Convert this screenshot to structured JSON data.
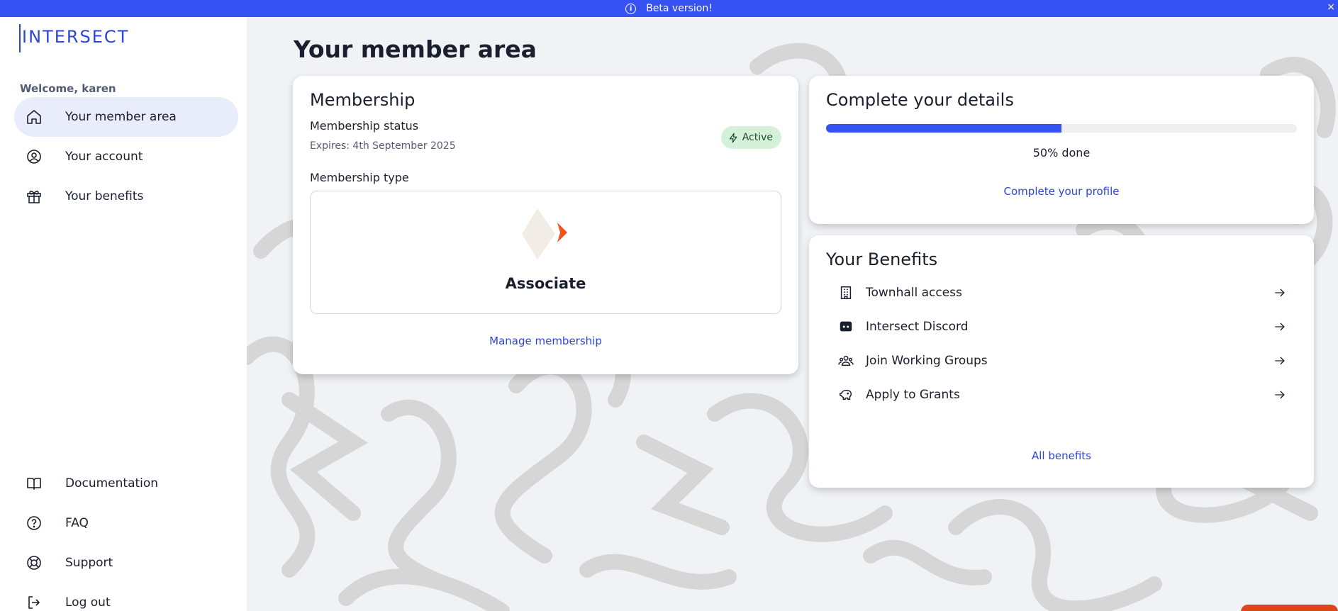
{
  "banner": {
    "text": "Beta version!",
    "close": "×"
  },
  "logo": {
    "text": "INTERSECT"
  },
  "welcome": "Welcome, karen",
  "nav": {
    "primary": [
      {
        "label": "Your member area",
        "icon": "home-icon",
        "active": true
      },
      {
        "label": "Your account",
        "icon": "user-circle-icon",
        "active": false
      },
      {
        "label": "Your benefits",
        "icon": "gift-icon",
        "active": false
      }
    ],
    "secondary": [
      {
        "label": "Documentation",
        "icon": "book-icon"
      },
      {
        "label": "FAQ",
        "icon": "help-circle-icon"
      },
      {
        "label": "Support",
        "icon": "lifebuoy-icon"
      },
      {
        "label": "Log out",
        "icon": "logout-icon"
      }
    ]
  },
  "page_title": "Your member area",
  "membership": {
    "title": "Membership",
    "status_label": "Membership status",
    "expires": "Expires: 4th September 2025",
    "badge": "Active",
    "type_label": "Membership type",
    "type_name": "Associate",
    "manage_link": "Manage membership"
  },
  "details": {
    "title": "Complete your details",
    "progress_percent": 50,
    "progress_text": "50% done",
    "link": "Complete your profile"
  },
  "benefits": {
    "title": "Your Benefits",
    "items": [
      {
        "label": "Townhall access",
        "icon": "building-icon"
      },
      {
        "label": "Intersect Discord",
        "icon": "discord-icon"
      },
      {
        "label": "Join Working Groups",
        "icon": "users-icon"
      },
      {
        "label": "Apply to Grants",
        "icon": "piggy-bank-icon"
      }
    ],
    "link": "All benefits"
  },
  "colors": {
    "accent": "#3752f3",
    "badge_bg": "#d6f1da",
    "active_nav_bg": "#e9ecfb",
    "brand": "#2d45d8"
  }
}
